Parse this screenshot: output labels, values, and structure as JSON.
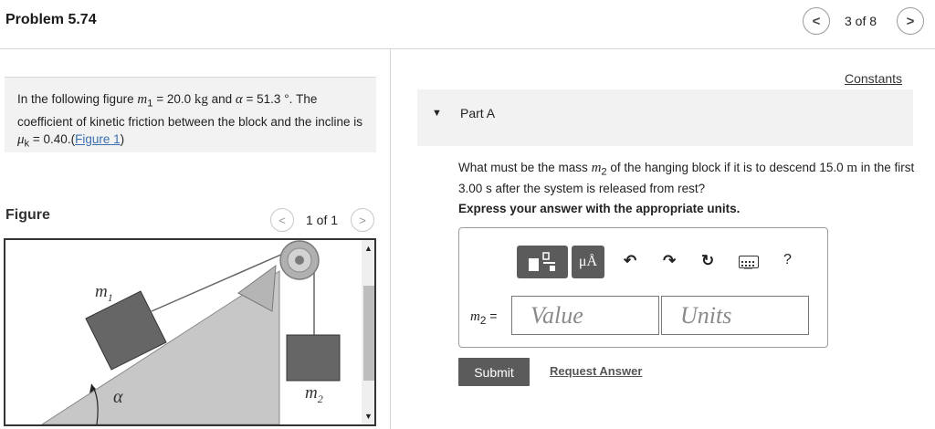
{
  "header": {
    "title": "Problem 5.74",
    "prev_label": "<",
    "next_label": ">",
    "page_counter": "3 of 8"
  },
  "intro": {
    "t1": "In the following figure ",
    "m1_sym": "m",
    "m1_sub": "1",
    "t2": " = 20.0 ",
    "kg": "kg",
    "t3": " and ",
    "alpha": "α",
    "t4": " = 51.3 °. The coefficient of kinetic friction between the block and the incline is ",
    "mu": "μ",
    "mu_sub": "k",
    "t5": " = 0.40.(",
    "fig_link": "Figure 1",
    "t6": ")"
  },
  "figure": {
    "label": "Figure",
    "prev_label": "<",
    "next_label": ">",
    "counter": "1 of 1",
    "m1_label": "m",
    "m1_sub": "1",
    "m2_label": "m",
    "m2_sub": "2",
    "alpha_label": "α",
    "scroll_up": "▲",
    "scroll_down": "▼"
  },
  "right": {
    "constants": "Constants",
    "part_caret": "▼",
    "part_title": "Part A",
    "q1": "What must be the mass ",
    "q_m": "m",
    "q_sub": "2",
    "q2": " of the hanging block if it is to descend 15.0 ",
    "q_unit": "m",
    "q3": " in the first 3.00 s after the system is released from rest?",
    "instruction": "Express your answer with the appropriate units."
  },
  "answer": {
    "toolbar": {
      "templates_icon": "templates-icon",
      "units_label": "μÅ",
      "undo": "↶",
      "redo": "↷",
      "reset": "↻",
      "help": "?"
    },
    "var_label": "m",
    "var_sub": "2",
    "equals": " =",
    "value_placeholder": "Value",
    "units_placeholder": "Units",
    "submit": "Submit",
    "request": "Request Answer"
  },
  "colors": {
    "button_gray": "#5b5b5b",
    "panel_bg": "#f2f2f2",
    "link_blue": "#3a6fb0",
    "block_gray": "#666666",
    "incline_gray": "#c7c7c7"
  }
}
